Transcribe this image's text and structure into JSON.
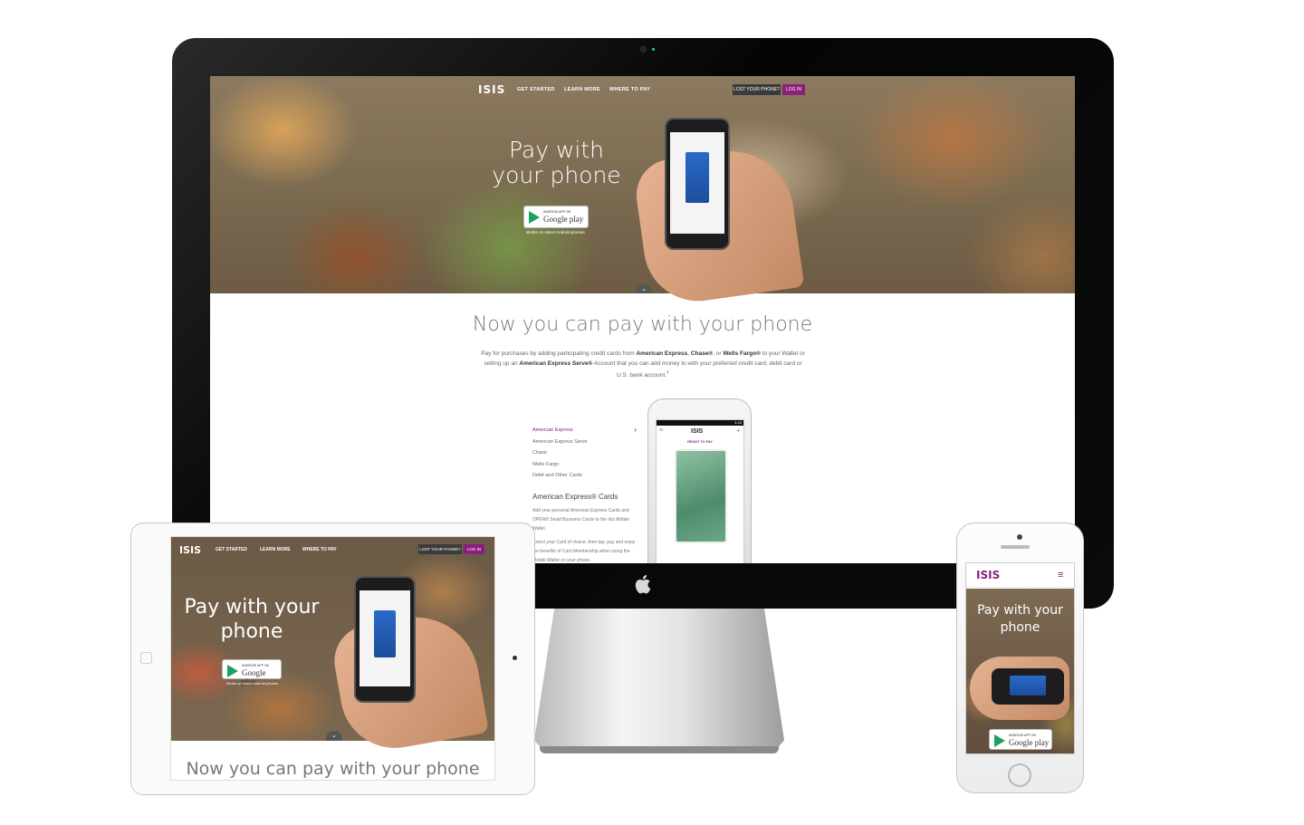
{
  "brand": {
    "logo": "ISIS",
    "accent": "#8a1f7d"
  },
  "desktop": {
    "nav": {
      "links": [
        "GET STARTED",
        "LEARN MORE",
        "WHERE TO PAY"
      ],
      "lost_phone": "LOST YOUR PHONE?",
      "login": "LOG IN"
    },
    "hero": {
      "title": "Pay with your phone",
      "badge_small": "ANDROID APP ON",
      "badge_big": "Google play",
      "works_note": "Works on select Android phones."
    },
    "section": {
      "title": "Now you can pay with your phone",
      "body_1": "Pay for purchases by adding participating credit cards from ",
      "amex": "American Express",
      "body_2": ", ",
      "chase": "Chase®",
      "body_3": ", or ",
      "wells": "Wells Fargo®",
      "body_4": " to your Wallet or setting up an ",
      "serve": "American Express Serve®",
      "body_5": " Account that you can add money to with your preferred credit card, debit card or U.S. bank account.",
      "dagger": "†"
    },
    "card_list": [
      "American Express",
      "American Express Serve",
      "Chase",
      "Wells Fargo",
      "Debit and Other Cards"
    ],
    "amex_heading": "American Express® Cards",
    "amex_body_1": "Add your personal American Express Cards and OPEN® Small Business Cards to the Isis Mobile Wallet.",
    "amex_body_2": "Select your Card of choice, then tap, pay and enjoy the benefits of Card Membership when using the Mobile Wallet on your phone.",
    "phone_ready": "READY TO PAY",
    "phone_time": "4:43"
  },
  "tablet": {
    "nav": {
      "links": [
        "GET STARTED",
        "LEARN MORE",
        "WHERE TO PAY"
      ],
      "lost_phone": "LOST YOUR PHONE?",
      "login": "LOG IN"
    },
    "hero_title": "Pay with your phone",
    "badge_small": "ANDROID APP ON",
    "badge_big": "Google play",
    "works_note": "Works on select Android phones.",
    "section_title": "Now you can pay with your phone"
  },
  "mobile": {
    "hero_title": "Pay with your phone",
    "badge_small": "ANDROID APP ON",
    "badge_big": "Google play"
  },
  "icons": {
    "apple": "apple-logo-icon",
    "menu": "hamburger-menu-icon",
    "chevron": "chevron-down-icon"
  }
}
